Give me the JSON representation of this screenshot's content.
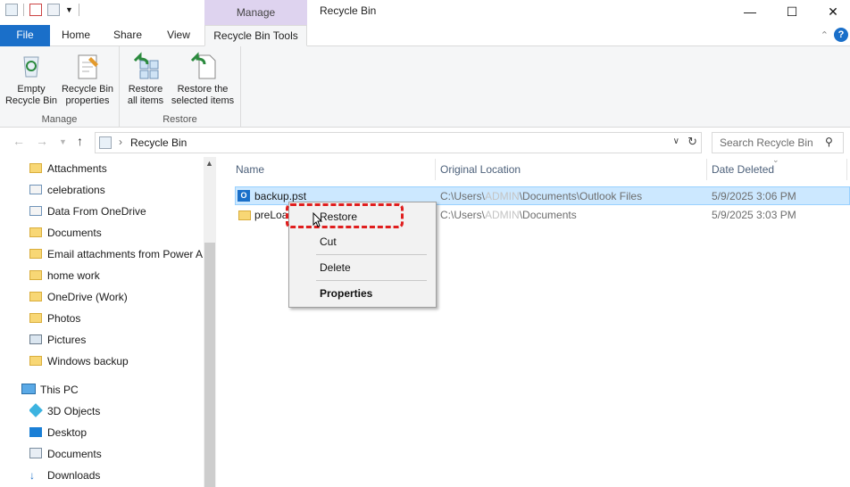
{
  "window": {
    "title": "Recycle Bin",
    "context_tab": "Manage",
    "minimize": "—",
    "maximize": "☐",
    "close": "✕"
  },
  "ribbon_tabs": [
    "File",
    "Home",
    "Share",
    "View",
    "Recycle Bin Tools"
  ],
  "ribbon": {
    "manage_group": {
      "label": "Manage",
      "empty_line1": "Empty",
      "empty_line2": "Recycle Bin",
      "props_line1": "Recycle Bin",
      "props_line2": "properties"
    },
    "restore_group": {
      "label": "Restore",
      "all_line1": "Restore",
      "all_line2": "all items",
      "sel_line1": "Restore the",
      "sel_line2": "selected items"
    }
  },
  "address": {
    "path": "Recycle Bin",
    "search_placeholder": "Search Recycle Bin"
  },
  "nav": {
    "folders": [
      "Attachments",
      "celebrations",
      "Data From OneDrive",
      "Documents",
      "Email attachments from Power A",
      "home work",
      "OneDrive (Work)",
      "Photos",
      "Pictures",
      "Windows backup"
    ],
    "this_pc": "This PC",
    "pc_items": [
      "3D Objects",
      "Desktop",
      "Documents",
      "Downloads"
    ]
  },
  "columns": {
    "name": "Name",
    "original_location": "Original Location",
    "date_deleted": "Date Deleted"
  },
  "files": [
    {
      "name": "backup.pst",
      "loc_prefix": "C:\\Users\\",
      "loc_user": "ADMIN",
      "loc_suffix": "\\Documents\\Outlook Files",
      "date": "5/9/2025 3:06 PM"
    },
    {
      "name": "preLoa",
      "loc_prefix": "C:\\Users\\",
      "loc_user": "ADMIN",
      "loc_suffix": "\\Documents",
      "date": "5/9/2025 3:03 PM"
    }
  ],
  "context_menu": {
    "restore": "Restore",
    "cut": "Cut",
    "delete": "Delete",
    "properties": "Properties"
  },
  "colors": {
    "file_tab": "#1a6fc9",
    "manage_tab": "#ded3ef",
    "selection": "#cce8ff",
    "highlight": "#e01e1e"
  }
}
